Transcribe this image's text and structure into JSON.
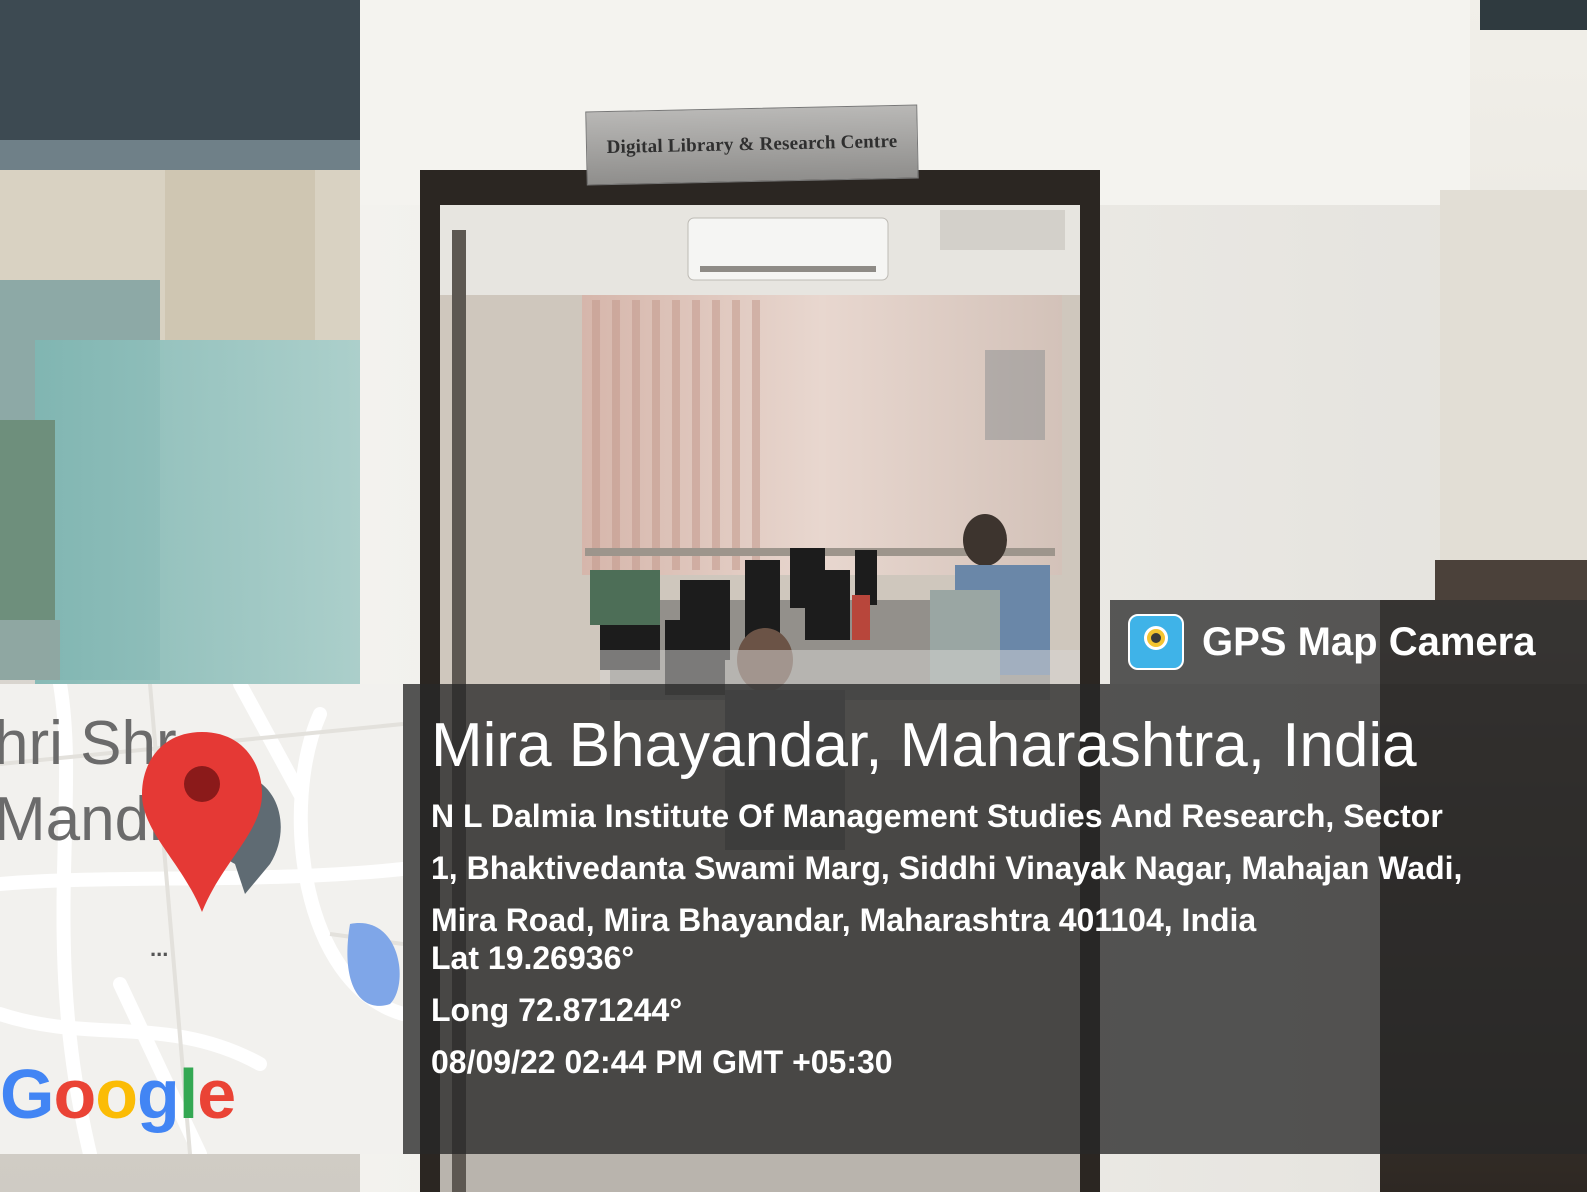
{
  "photo": {
    "sign_text": "Digital Library & Research Centre"
  },
  "badge": {
    "app_name": "GPS Map Camera",
    "icon": "gps-map-camera-icon"
  },
  "map": {
    "label_line1": "hri Shr",
    "label_line2": "Mandi",
    "ellipsis": "...",
    "google": [
      "G",
      "o",
      "o",
      "g",
      "l",
      "e"
    ],
    "google_display": "Google",
    "pin_icon": "map-pin-icon",
    "colors": {
      "pin": "#e53935",
      "pin_dot": "#8b1a1a",
      "water": "#7fa6e8",
      "badge": "#5f6b73"
    }
  },
  "info": {
    "city": "Mira Bhayandar, Maharashtra, India",
    "address_line1": "N L Dalmia Institute Of Management Studies And Research, Sector",
    "address_line2": "1, Bhaktivedanta Swami Marg, Siddhi Vinayak Nagar, Mahajan Wadi,",
    "address_line3": "Mira Road, Mira Bhayandar, Maharashtra 401104, India",
    "lat": "Lat 19.26936°",
    "long": "Long 72.871244°",
    "datetime": "08/09/22 02:44 PM GMT +05:30"
  }
}
